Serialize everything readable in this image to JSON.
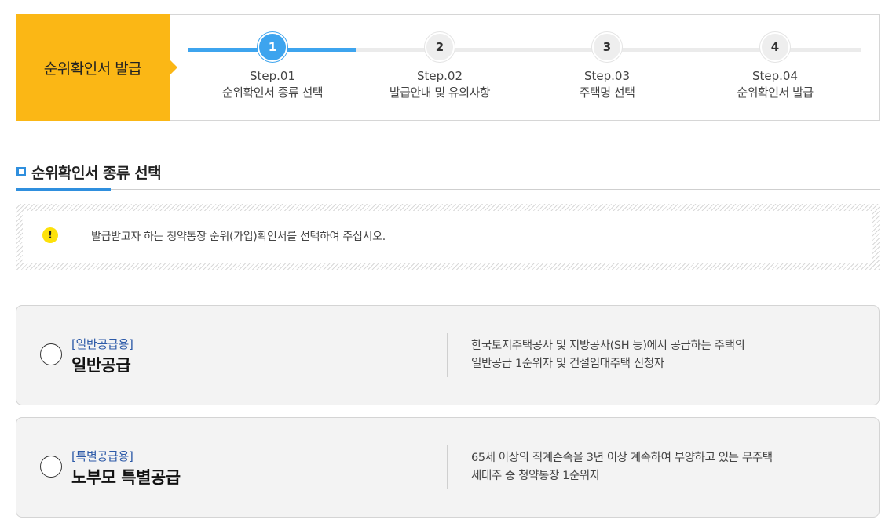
{
  "stepper": {
    "title": "순위확인서 발급",
    "steps": [
      {
        "number": "1",
        "step": "Step.01",
        "label": "순위확인서 종류 선택",
        "current": true
      },
      {
        "number": "2",
        "step": "Step.02",
        "label": "발급안내 및 유의사항",
        "current": false
      },
      {
        "number": "3",
        "step": "Step.03",
        "label": "주택명 선택",
        "current": false
      },
      {
        "number": "4",
        "step": "Step.04",
        "label": "순위확인서 발급",
        "current": false
      }
    ]
  },
  "section": {
    "title": "순위확인서 종류 선택"
  },
  "notice": {
    "icon": "exclamation-icon",
    "icon_glyph": "!",
    "text": "발급받고자 하는 청약통장 순위(가입)확인서를 선택하여 주십시오."
  },
  "options": [
    {
      "tag": "[일반공급용]",
      "title": "일반공급",
      "desc_line1": "한국토지주택공사 및 지방공사(SH 등)에서 공급하는 주택의",
      "desc_line2": "일반공급 1순위자 및 건설임대주택 신청자",
      "selected": false
    },
    {
      "tag": "[특별공급용]",
      "title": "노부모 특별공급",
      "desc_line1": "65세 이상의 직계존속을 3년 이상 계속하여 부양하고 있는 무주택",
      "desc_line2": "세대주 중 청약통장 1순위자",
      "selected": false
    }
  ],
  "colors": {
    "accent_yellow": "#fbb715",
    "accent_blue": "#3da4ee",
    "tag_blue": "#2d5aa8"
  }
}
